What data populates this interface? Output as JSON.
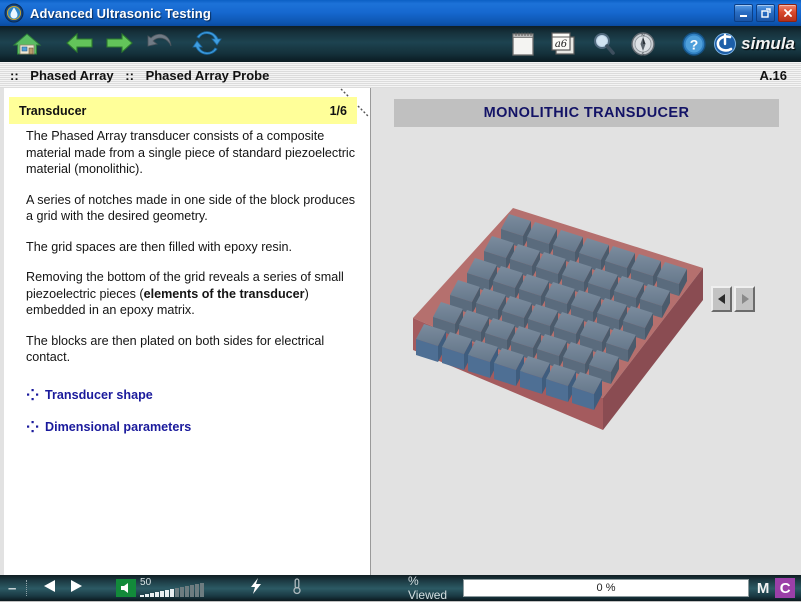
{
  "window": {
    "title": "Advanced Ultrasonic Testing",
    "app_icon": "water-drop-icon",
    "controls": {
      "minimize": "minimize-button",
      "maximize": "maximize-button",
      "close": "close-button"
    }
  },
  "toolbar": {
    "items": [
      {
        "name": "home-icon",
        "label": "Home"
      },
      {
        "name": "back-arrow-icon",
        "label": "Back"
      },
      {
        "name": "forward-arrow-icon",
        "label": "Forward"
      },
      {
        "name": "undo-icon",
        "label": "Undo"
      },
      {
        "name": "refresh-icon",
        "label": "Refresh"
      },
      {
        "name": "notes-icon",
        "label": "Notes"
      },
      {
        "name": "glossary-icon",
        "label": "Glossary"
      },
      {
        "name": "search-icon",
        "label": "Search"
      },
      {
        "name": "compass-icon",
        "label": "Navigate"
      },
      {
        "name": "help-icon",
        "label": "Help"
      }
    ],
    "brand": "simula"
  },
  "breadcrumb": {
    "prefix": "::",
    "level1": "Phased Array",
    "separator": "::",
    "level2": "Phased Array Probe",
    "page_ref": "A.16"
  },
  "left_panel": {
    "topic_title": "Transducer",
    "topic_count": "1/6",
    "paragraphs": [
      "The Phased Array transducer consists of a composite material made from a single piece of standard piezoelectric material (monolithic).",
      "A series of notches made in one side of the block produces a grid with the desired geometry.",
      "The grid spaces are then filled with epoxy resin.",
      "The blocks are then plated on both sides for electrical contact."
    ],
    "highlight_paragraph": {
      "before": "Removing the bottom of the grid reveals a series of small piezoelectric pieces (",
      "bold": "elements of the transducer",
      "after": ") embedded in an epoxy matrix."
    },
    "links": [
      "Transducer shape",
      "Dimensional parameters"
    ]
  },
  "right_panel": {
    "figure_title": "MONOLITHIC TRANSDUCER",
    "figure_alt": "monolithic-transducer-grid-diagram",
    "nav_prev": "◀",
    "nav_next": "▶"
  },
  "status_bar": {
    "minus": "–",
    "prev": "◀",
    "next": "▶",
    "speaker_icon": "speaker-icon",
    "volume_value": "50",
    "bolt_icon": "lightning-icon",
    "thermo_icon": "thermometer-icon",
    "viewed_label": "% Viewed",
    "viewed_value": "0 %",
    "m_button": "M",
    "c_button": "C"
  },
  "colors": {
    "titlebar": "#1668cf",
    "toolbar": "#1d4350",
    "highlight": "#ffff99",
    "link": "#1a1a9c",
    "figure_title": "#131366",
    "accent_purple": "#9b3fa8"
  }
}
